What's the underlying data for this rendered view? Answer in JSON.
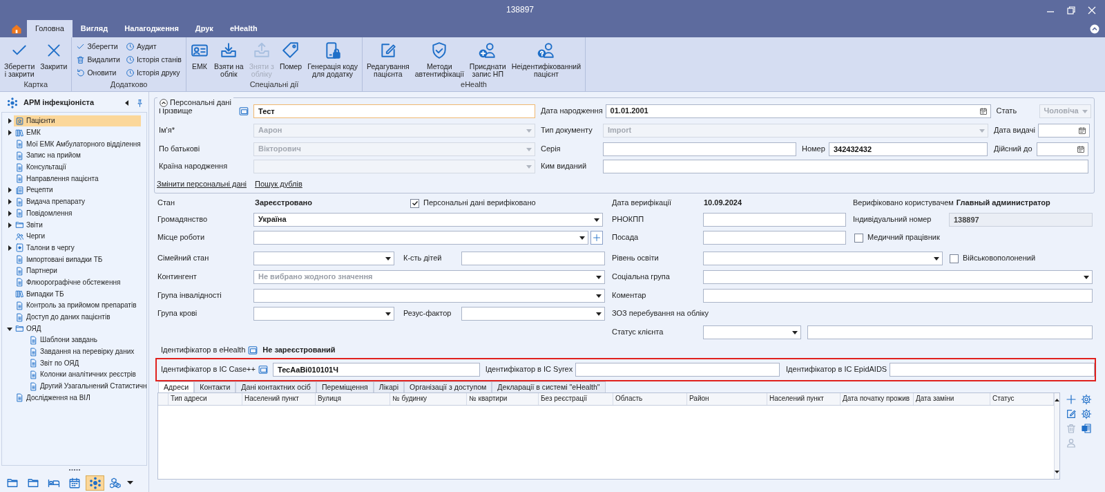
{
  "window": {
    "title": "138897"
  },
  "ribbon_tabs": [
    {
      "label": "Головна",
      "selected": true
    },
    {
      "label": "Вигляд",
      "selected": false
    },
    {
      "label": "Налагодження",
      "selected": false
    },
    {
      "label": "Друк",
      "selected": false
    },
    {
      "label": "eHealth",
      "selected": false
    }
  ],
  "ribbon_groups": [
    {
      "label": "Картка",
      "buttons": [
        {
          "label": "Зберегти\nі закрити",
          "kind": "large",
          "disabled": false
        },
        {
          "label": "Закрити",
          "kind": "large",
          "disabled": false
        }
      ]
    },
    {
      "label": "Додатково",
      "buttons": [
        {
          "label": "Зберегти",
          "kind": "small",
          "disabled": false
        },
        {
          "label": "Видалити",
          "kind": "small",
          "disabled": false
        },
        {
          "label": "Оновити",
          "kind": "small",
          "disabled": false
        },
        {
          "label": "Аудит",
          "kind": "small",
          "disabled": false
        },
        {
          "label": "Історія станів",
          "kind": "small",
          "disabled": false
        },
        {
          "label": "Історія друку",
          "kind": "small",
          "disabled": false
        }
      ]
    },
    {
      "label": "Спеціальні дії",
      "buttons": [
        {
          "label": "ЕМК",
          "kind": "large",
          "disabled": false
        },
        {
          "label": "Взяти на\nоблік",
          "kind": "large",
          "disabled": false
        },
        {
          "label": "Зняти з\nобліку",
          "kind": "large",
          "disabled": true
        },
        {
          "label": "Помер",
          "kind": "large",
          "disabled": false
        },
        {
          "label": "Генерація коду\nдля додатку",
          "kind": "large",
          "disabled": false
        }
      ]
    },
    {
      "label": "eHealth",
      "buttons": [
        {
          "label": "Редагування\nпацієнта",
          "kind": "large",
          "disabled": false
        },
        {
          "label": "Методи\nавтентифікації",
          "kind": "large",
          "disabled": false
        },
        {
          "label": "Приєднати\nзапис НП",
          "kind": "large",
          "disabled": false
        },
        {
          "label": "Неідентифікованний\nпацієнт",
          "kind": "large",
          "disabled": false
        }
      ]
    }
  ],
  "sidebar": {
    "title": "АРМ інфекціоніста",
    "items": [
      {
        "label": "Пацієнти",
        "selected": true,
        "expanded": false
      },
      {
        "label": "ЕМК",
        "selected": false,
        "expanded": false
      },
      {
        "label": "Мої ЕМК Амбулаторного відділення",
        "selected": false
      },
      {
        "label": "Запис на прийом",
        "selected": false
      },
      {
        "label": "Консультації",
        "selected": false
      },
      {
        "label": "Направлення пацієнта",
        "selected": false
      },
      {
        "label": "Рецепти",
        "selected": false,
        "expanded": false
      },
      {
        "label": "Видача препарату",
        "selected": false,
        "expanded": false
      },
      {
        "label": "Повідомлення",
        "selected": false,
        "expanded": false
      },
      {
        "label": "Звіти",
        "selected": false,
        "expanded": false
      },
      {
        "label": "Черги",
        "selected": false
      },
      {
        "label": "Талони в чергу",
        "selected": false,
        "expanded": false
      },
      {
        "label": "Імпортовані випадки ТБ",
        "selected": false
      },
      {
        "label": "Партнери",
        "selected": false
      },
      {
        "label": "Флюорографічне обстеження",
        "selected": false
      },
      {
        "label": "Випадки ТБ",
        "selected": false
      },
      {
        "label": "Контроль за прийомом препаратів",
        "selected": false
      },
      {
        "label": "Доступ до даних пацієнтів",
        "selected": false
      },
      {
        "label": "ОЯД",
        "selected": false,
        "expanded": true,
        "children": [
          {
            "label": "Шаблони завдань",
            "selected": false
          },
          {
            "label": "Завдання на перевірку даних",
            "selected": false
          },
          {
            "label": "Звіт по ОЯД",
            "selected": false
          },
          {
            "label": "Колонки аналітичних реєстрів",
            "selected": false
          },
          {
            "label": "Другий Узагальнений Статистичн",
            "selected": false
          }
        ]
      },
      {
        "label": "Дослідження на ВІЛ",
        "selected": false
      }
    ],
    "nav_buttons": [
      {
        "selected": false
      },
      {
        "selected": false
      },
      {
        "selected": false
      },
      {
        "selected": false
      },
      {
        "selected": true
      },
      {
        "selected": false
      }
    ]
  },
  "personal_data": {
    "title": "Персональні дані",
    "expanded": true,
    "fields": [
      {
        "label": "Прізвище",
        "kind": "input",
        "value": "Тест",
        "lookup_button": true,
        "disabled": false,
        "focused": true
      },
      {
        "label": "Дата народження",
        "kind": "date",
        "value": "01.01.2001",
        "disabled": false
      },
      {
        "label": "Стать",
        "kind": "combo",
        "value": "Чоловіча",
        "disabled": true
      },
      {
        "label": "Ім'я*",
        "kind": "combo",
        "value": "Аарон",
        "disabled": true
      },
      {
        "label": "Тип документу",
        "kind": "combo",
        "value": "Import",
        "disabled": true
      },
      {
        "label": "Дата видачі",
        "kind": "date",
        "disabled": false
      },
      {
        "label": "По батькові",
        "kind": "combo",
        "value": "Вікторович",
        "disabled": true
      },
      {
        "label": "Серія",
        "kind": "input",
        "disabled": false,
        "focused": false
      },
      {
        "label": "Номер",
        "kind": "input",
        "value": "342432432",
        "disabled": false,
        "focused": false
      },
      {
        "label": "Дійсний до",
        "kind": "date",
        "disabled": false
      },
      {
        "label": "Країна народження",
        "kind": "combo",
        "disabled": true
      },
      {
        "label": "Ким виданий",
        "kind": "input",
        "disabled": false,
        "focused": false
      }
    ],
    "links": [
      "Змінити персональні дані",
      "Пошук дублів"
    ]
  },
  "details": {
    "fields": [
      {
        "label": "Стан",
        "kind": "value",
        "value": "Зареєстровано"
      },
      {
        "label": "Персональні дані верифіковано",
        "kind": "checkbox",
        "checked": true
      },
      {
        "label": "Дата верифікації",
        "kind": "value",
        "value": "10.09.2024"
      },
      {
        "label": "Верифіковано користувачем",
        "kind": "value",
        "value": "Главный администратор"
      },
      {
        "label": "Громадянство",
        "kind": "combo",
        "value": "Україна",
        "disabled": false
      },
      {
        "label": "РНОКПП",
        "kind": "input",
        "disabled": false,
        "focused": false
      },
      {
        "label": "Індивідуальний номер",
        "kind": "input",
        "value": "138897",
        "disabled": true,
        "focused": false
      },
      {
        "label": "Місце роботи",
        "kind": "combo",
        "add_button": true,
        "disabled": false
      },
      {
        "label": "Посада",
        "kind": "input",
        "disabled": false,
        "focused": false
      },
      {
        "label": "Медичний працівник",
        "kind": "checkbox",
        "checked": false
      },
      {
        "label": "Сімейний стан",
        "kind": "combo",
        "disabled": false
      },
      {
        "label": "К-сть дітей",
        "kind": "input",
        "disabled": false,
        "focused": false
      },
      {
        "label": "Рівень освіти",
        "kind": "combo",
        "disabled": false
      },
      {
        "label": "Військовополонений",
        "kind": "checkbox",
        "checked": false
      },
      {
        "label": "Контингент",
        "kind": "combo",
        "placeholder": "Не вибрано жодного значення",
        "disabled": false
      },
      {
        "label": "Соціальна група",
        "kind": "combo",
        "disabled": false
      },
      {
        "label": "Група інвалідності",
        "kind": "combo",
        "disabled": false
      },
      {
        "label": "Коментар",
        "kind": "input",
        "disabled": false,
        "focused": false
      },
      {
        "label": "Група крові",
        "kind": "combo",
        "disabled": false
      },
      {
        "label": "Резус-фактор",
        "kind": "combo",
        "disabled": false
      },
      {
        "label": "ЗОЗ перебування на обліку",
        "kind": "caption"
      },
      {
        "label": "Статус клієнта",
        "kind": "combo",
        "disabled": false
      },
      {
        "kind": "input",
        "disabled": false,
        "focused": false
      },
      {
        "label": "Ідентифікатор в eHealth",
        "kind": "value",
        "value": "Не зареєстрований",
        "lookup_button": true
      }
    ]
  },
  "identifiers": {
    "highlighted": true,
    "fields": [
      {
        "label": "Ідентифікатор в IC Case++",
        "kind": "input",
        "value": "ТесАаВі010101Ч",
        "lookup_button": true,
        "disabled": false,
        "focused": false
      },
      {
        "label": "Ідентифікатор в IC Syrex",
        "kind": "input",
        "disabled": false,
        "focused": false
      },
      {
        "label": "Ідентифікатор в IC EpidAIDS",
        "kind": "input",
        "disabled": false,
        "focused": false
      }
    ]
  },
  "detail_tabs": [
    {
      "label": "Адреси",
      "selected": true
    },
    {
      "label": "Контакти",
      "selected": false
    },
    {
      "label": "Дані контактних осіб",
      "selected": false
    },
    {
      "label": "Переміщення",
      "selected": false
    },
    {
      "label": "Лікарі",
      "selected": false
    },
    {
      "label": "Організації з доступом",
      "selected": false
    },
    {
      "label": "Декларації в системі \"eHealth\"",
      "selected": false
    }
  ],
  "table": {
    "columns": [
      "Тип адреси",
      "Населений пункт",
      "Вулиця",
      "№ будинку",
      "№ квартири",
      "Без реєстрації",
      "Область",
      "Район",
      "Населений пункт",
      "Дата початку прожив",
      "Дата заміни",
      "Статус"
    ]
  },
  "table_actions": [
    {
      "disabled": false
    },
    {
      "disabled": false
    },
    {
      "disabled": false
    },
    {
      "disabled": false
    },
    {
      "disabled": true
    },
    {
      "disabled": false
    },
    {
      "disabled": true
    }
  ]
}
